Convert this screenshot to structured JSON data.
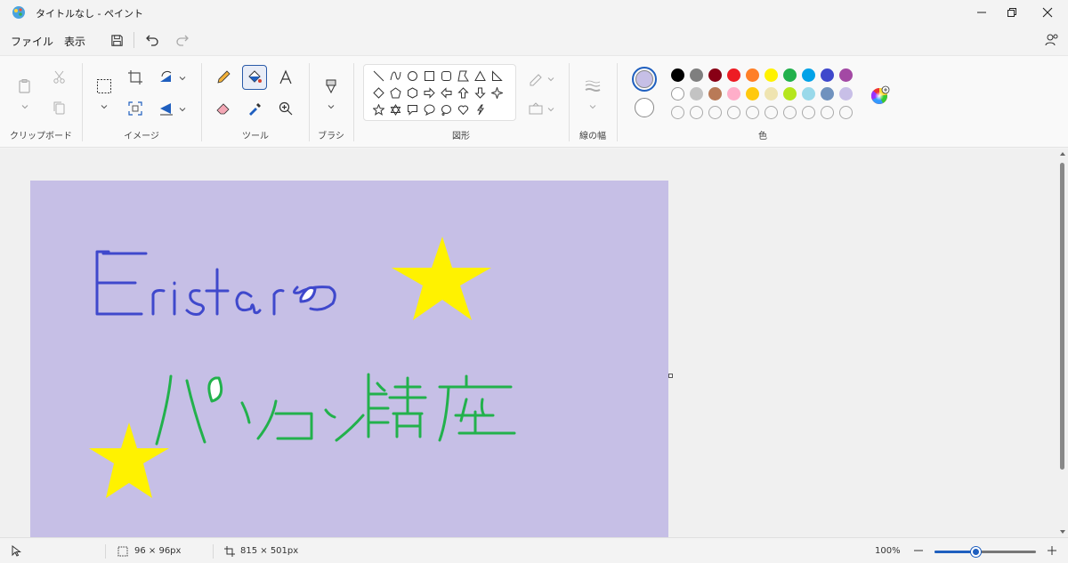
{
  "window": {
    "title": "タイトルなし - ペイント",
    "minimize_icon": "minimize-icon",
    "restore_icon": "restore-icon",
    "close_icon": "close-icon"
  },
  "menu": {
    "file_label": "ファイル",
    "view_label": "表示",
    "save_icon": "save-icon",
    "undo_icon": "undo-icon",
    "redo_icon": "redo-icon",
    "share_icon": "share-icon"
  },
  "ribbon": {
    "groups": {
      "clipboard": "クリップボード",
      "image": "イメージ",
      "tools": "ツール",
      "brushes": "ブラシ",
      "shapes": "図形",
      "size": "線の幅",
      "colors": "色"
    },
    "active_tool": "fill-bucket",
    "current_color_1": "#c6bfe6",
    "current_color_2": "#ffffff",
    "palette_row1": [
      "#000000",
      "#7f7f7f",
      "#880015",
      "#ed1c24",
      "#ff7f27",
      "#fff200",
      "#22b14c",
      "#00a2e8",
      "#3f48cc",
      "#a349a4"
    ],
    "palette_row2": [
      "#ffffff",
      "#c3c3c3",
      "#b97a57",
      "#ffaec9",
      "#ffc90e",
      "#efe4b0",
      "#b5e61d",
      "#99d9ea",
      "#7092be",
      "#c8bfe7"
    ]
  },
  "canvas": {
    "background": "#c6bfe6",
    "drawing_colors": {
      "blue_text": "#3f48cc",
      "green_text": "#22b14c",
      "star": "#fff200"
    }
  },
  "status": {
    "selection_size": "96 × 96px",
    "canvas_size": "815 × 501px",
    "zoom_level": "100%",
    "zoom_fraction": 0.4
  }
}
